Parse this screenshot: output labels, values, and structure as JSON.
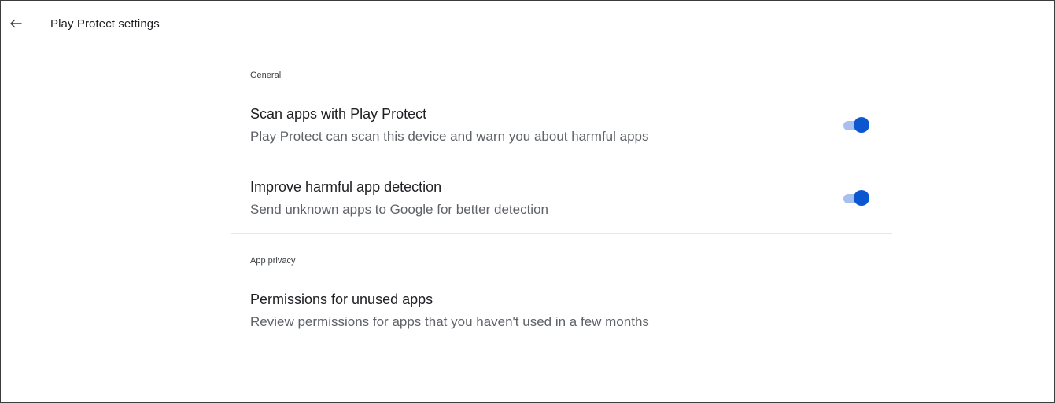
{
  "header": {
    "back_icon": "arrow-back-icon",
    "title": "Play Protect settings"
  },
  "sections": {
    "general": {
      "label": "General",
      "items": [
        {
          "title": "Scan apps with Play Protect",
          "subtitle": "Play Protect can scan this device and warn you about harmful apps",
          "toggle_on": true
        },
        {
          "title": "Improve harmful app detection",
          "subtitle": "Send unknown apps to Google for better detection",
          "toggle_on": true
        }
      ]
    },
    "app_privacy": {
      "label": "App privacy",
      "items": [
        {
          "title": "Permissions for unused apps",
          "subtitle": "Review permissions for apps that you haven't used in a few months"
        }
      ]
    }
  },
  "colors": {
    "toggle_thumb": "#0b57d0",
    "toggle_track": "#a8c0f0",
    "title_text": "#202124",
    "subtitle_text": "#5f6368"
  }
}
